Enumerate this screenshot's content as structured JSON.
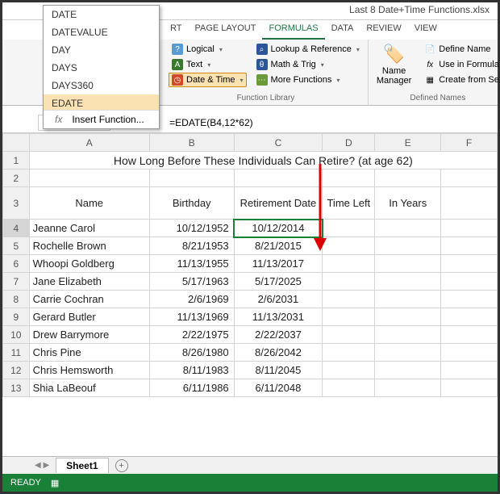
{
  "titlebar": {
    "filename": "Last 8 Date+Time Functions.xlsx"
  },
  "tabs": {
    "t1": "RT",
    "t2": "PAGE LAYOUT",
    "t3": "FORMULAS",
    "t4": "DATA",
    "t5": "REVIEW",
    "t6": "VIEW"
  },
  "ribbon": {
    "logical": "Logical",
    "text": "Text",
    "datetime": "Date & Time",
    "lookup": "Lookup & Reference",
    "math": "Math & Trig",
    "more": "More Functions",
    "namemgr": "Name Manager",
    "defname": "Define Name",
    "usein": "Use in Formula",
    "createfrom": "Create from Se",
    "grp1": "Function Library",
    "grp2": "Defined Names"
  },
  "dropdown": {
    "items": [
      "DATE",
      "DATEVALUE",
      "DAY",
      "DAYS",
      "DAYS360",
      "EDATE"
    ],
    "insert": "Insert Function..."
  },
  "formula": {
    "cellref": "C4",
    "value": "=EDATE(B4,12*62)"
  },
  "sheet": {
    "cols": [
      "A",
      "B",
      "C",
      "D",
      "E",
      "F"
    ],
    "title": "How Long Before These Individuals Can Retire? (at age 62)",
    "h_name": "Name",
    "h_bday": "Birthday",
    "h_ret": "Retirement Date",
    "h_time": "Time Left",
    "h_yrs": "In Years",
    "rows": [
      {
        "n": "Jeanne Carol",
        "b": "10/12/1952",
        "r": "10/12/2014"
      },
      {
        "n": "Rochelle Brown",
        "b": "8/21/1953",
        "r": "8/21/2015"
      },
      {
        "n": "Whoopi Goldberg",
        "b": "11/13/1955",
        "r": "11/13/2017"
      },
      {
        "n": "Jane Elizabeth",
        "b": "5/17/1963",
        "r": "5/17/2025"
      },
      {
        "n": "Carrie Cochran",
        "b": "2/6/1969",
        "r": "2/6/2031"
      },
      {
        "n": "Gerard Butler",
        "b": "11/13/1969",
        "r": "11/13/2031"
      },
      {
        "n": "Drew Barrymore",
        "b": "2/22/1975",
        "r": "2/22/2037"
      },
      {
        "n": "Chris Pine",
        "b": "8/26/1980",
        "r": "8/26/2042"
      },
      {
        "n": "Chris Hemsworth",
        "b": "8/11/1983",
        "r": "8/11/2045"
      },
      {
        "n": "Shia LaBeouf",
        "b": "6/11/1986",
        "r": "6/11/2048"
      }
    ]
  },
  "bottom": {
    "sheet1": "Sheet1",
    "ready": "READY"
  },
  "chart_data": {
    "type": "table",
    "title": "How Long Before These Individuals Can Retire? (at age 62)",
    "columns": [
      "Name",
      "Birthday",
      "Retirement Date",
      "Time Left",
      "In Years"
    ],
    "rows": [
      [
        "Jeanne Carol",
        "10/12/1952",
        "10/12/2014",
        "",
        ""
      ],
      [
        "Rochelle Brown",
        "8/21/1953",
        "8/21/2015",
        "",
        ""
      ],
      [
        "Whoopi Goldberg",
        "11/13/1955",
        "11/13/2017",
        "",
        ""
      ],
      [
        "Jane Elizabeth",
        "5/17/1963",
        "5/17/2025",
        "",
        ""
      ],
      [
        "Carrie Cochran",
        "2/6/1969",
        "2/6/2031",
        "",
        ""
      ],
      [
        "Gerard Butler",
        "11/13/1969",
        "11/13/2031",
        "",
        ""
      ],
      [
        "Drew Barrymore",
        "2/22/1975",
        "2/22/2037",
        "",
        ""
      ],
      [
        "Chris Pine",
        "8/26/1980",
        "8/26/2042",
        "",
        ""
      ],
      [
        "Chris Hemsworth",
        "8/11/1983",
        "8/11/2045",
        "",
        ""
      ],
      [
        "Shia LaBeouf",
        "6/11/1986",
        "6/11/2048",
        "",
        ""
      ]
    ]
  }
}
